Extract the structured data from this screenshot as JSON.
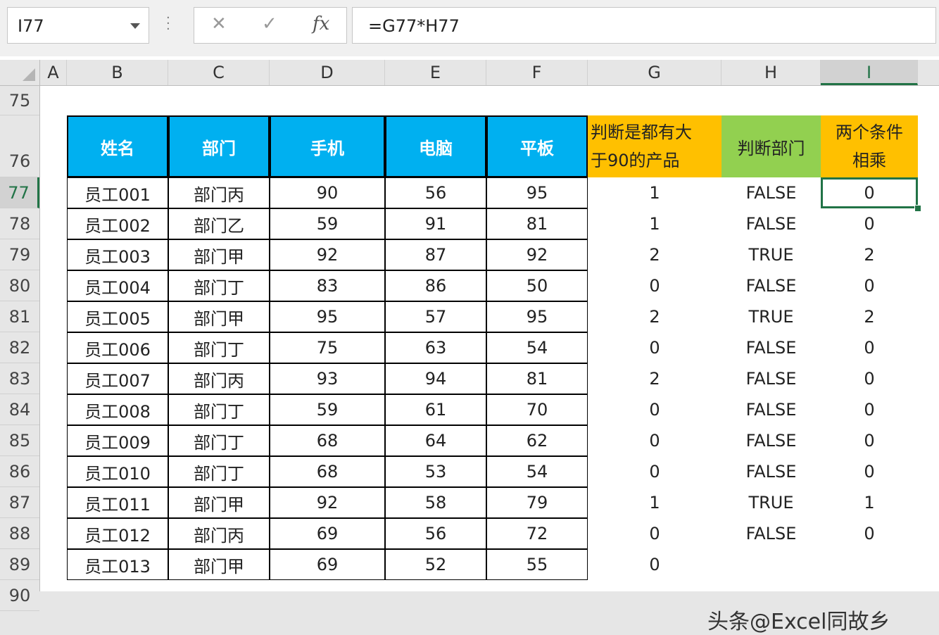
{
  "name_box": {
    "value": "I77"
  },
  "formula": {
    "value": "=G77*H77",
    "cancel_icon": "✕",
    "enter_icon": "✓",
    "fx_icon": "fx"
  },
  "columns": [
    "A",
    "B",
    "C",
    "D",
    "E",
    "F",
    "G",
    "H",
    "I"
  ],
  "selected_column": "I",
  "rows": [
    "75",
    "76",
    "77",
    "78",
    "79",
    "80",
    "81",
    "82",
    "83",
    "84",
    "85",
    "86",
    "87",
    "88",
    "89",
    "90"
  ],
  "selected_row": "77",
  "headers": {
    "name": "姓名",
    "dept": "部门",
    "phone": "手机",
    "pc": "电脑",
    "tablet": "平板",
    "g_line1": "判断是都有大",
    "g_line2": "于90的产品",
    "h": "判断部门",
    "i_line1": "两个条件",
    "i_line2": "相乘"
  },
  "table": [
    [
      "员工001",
      "部门丙",
      "90",
      "56",
      "95",
      "1",
      "FALSE",
      "0"
    ],
    [
      "员工002",
      "部门乙",
      "59",
      "91",
      "81",
      "1",
      "FALSE",
      "0"
    ],
    [
      "员工003",
      "部门甲",
      "92",
      "87",
      "92",
      "2",
      "TRUE",
      "2"
    ],
    [
      "员工004",
      "部门丁",
      "83",
      "86",
      "50",
      "0",
      "FALSE",
      "0"
    ],
    [
      "员工005",
      "部门甲",
      "95",
      "57",
      "95",
      "2",
      "TRUE",
      "2"
    ],
    [
      "员工006",
      "部门丁",
      "75",
      "63",
      "54",
      "0",
      "FALSE",
      "0"
    ],
    [
      "员工007",
      "部门丙",
      "93",
      "94",
      "81",
      "2",
      "FALSE",
      "0"
    ],
    [
      "员工008",
      "部门丁",
      "59",
      "61",
      "70",
      "0",
      "FALSE",
      "0"
    ],
    [
      "员工009",
      "部门丁",
      "68",
      "64",
      "62",
      "0",
      "FALSE",
      "0"
    ],
    [
      "员工010",
      "部门丁",
      "68",
      "53",
      "54",
      "0",
      "FALSE",
      "0"
    ],
    [
      "员工011",
      "部门甲",
      "92",
      "58",
      "79",
      "1",
      "TRUE",
      "1"
    ],
    [
      "员工012",
      "部门丙",
      "69",
      "56",
      "72",
      "0",
      "FALSE",
      "0"
    ],
    [
      "员工013",
      "部门甲",
      "69",
      "52",
      "55",
      "0",
      "",
      ""
    ]
  ],
  "watermark": "头条@Excel同故乡",
  "colors": {
    "accent": "#217346",
    "header_blue": "#00b0f0",
    "header_yellow": "#ffc000",
    "header_green": "#92d050"
  }
}
